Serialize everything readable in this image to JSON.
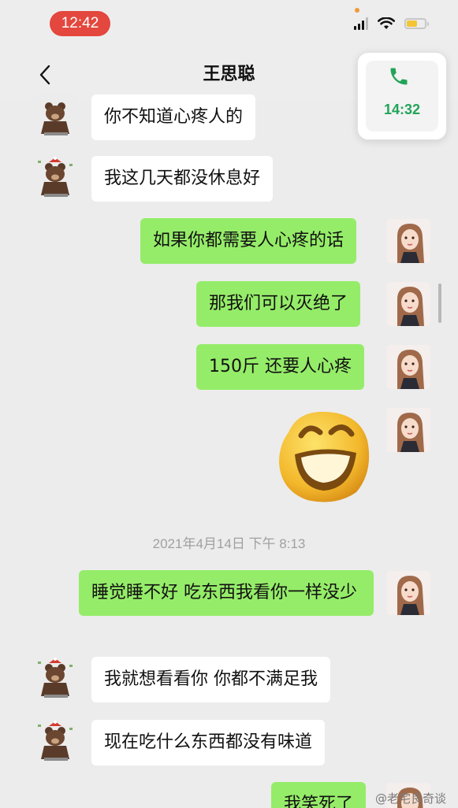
{
  "status_bar": {
    "time": "12:42",
    "icons": [
      "signal-icon",
      "wifi-icon",
      "battery-icon"
    ]
  },
  "nav": {
    "back_icon": "chevron-left-icon",
    "title": "王思聪"
  },
  "call_float": {
    "icon": "phone-icon",
    "duration": "14:32"
  },
  "messages": [
    {
      "side": "in",
      "text": "你不知道心疼人的"
    },
    {
      "side": "in",
      "text": "我这几天都没休息好"
    },
    {
      "side": "out",
      "text": "如果你都需要人心疼的话"
    },
    {
      "side": "out",
      "text": "那我们可以灭绝了"
    },
    {
      "side": "out",
      "text": "150斤 还要人心疼"
    },
    {
      "side": "out",
      "sticker": "laughing-emoji-sticker"
    },
    {
      "side": "out",
      "text": "睡觉睡不好 吃东西我看你一样没少"
    },
    {
      "side": "in",
      "text": "我就想看看你 你都不满足我"
    },
    {
      "side": "in",
      "text": "现在吃什么东西都没有味道"
    },
    {
      "side": "out",
      "text": "我笑死了"
    }
  ],
  "timestamp": "2021年4月14日 下午 8:13",
  "watermark": "@老宅良奇谈",
  "colors": {
    "outgoing_bubble": "#95ec69",
    "incoming_bubble": "#ffffff",
    "background": "#ececec",
    "time_pill": "#e3473d",
    "call_green": "#22a45a"
  }
}
